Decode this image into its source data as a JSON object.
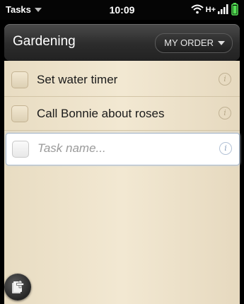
{
  "status_bar": {
    "app_menu_label": "Tasks",
    "time": "10:09",
    "network": "H+"
  },
  "header": {
    "title": "Gardening",
    "sort_button": "MY ORDER"
  },
  "tasks": [
    {
      "label": "Set water timer"
    },
    {
      "label": "Call Bonnie about roses"
    }
  ],
  "new_task": {
    "placeholder": "Task name..."
  },
  "icons": {
    "app_menu": "chevron-down-icon",
    "wifi": "wifi-icon",
    "signal": "signal-icon",
    "battery": "battery-icon",
    "info": "info-icon",
    "add": "add-task-icon"
  },
  "colors": {
    "accent_battery": "#54e154",
    "paper": "#f0e6cf"
  }
}
